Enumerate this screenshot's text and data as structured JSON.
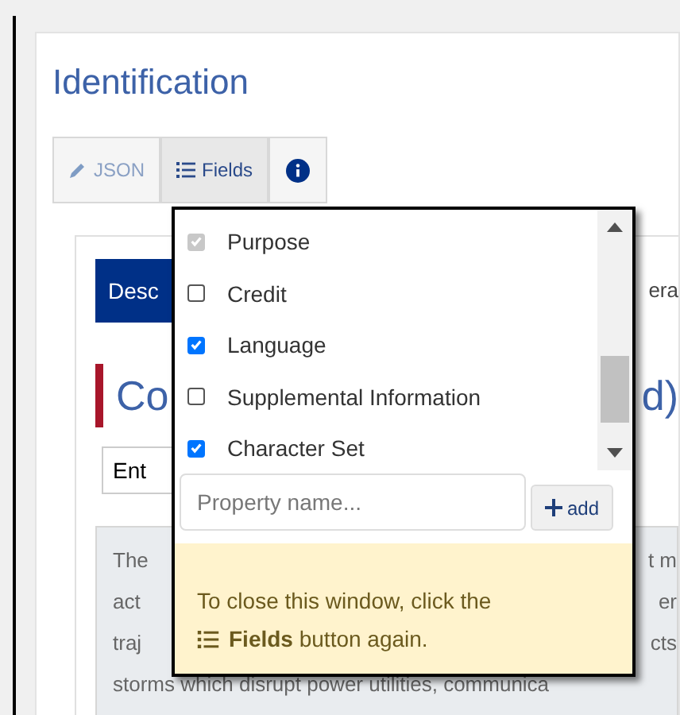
{
  "page": {
    "title": "Identification"
  },
  "toolbar": [
    {
      "kind": "json",
      "label": "JSON",
      "selected": false
    },
    {
      "kind": "fields",
      "label": "Fields",
      "selected": true
    },
    {
      "kind": "info",
      "selected": false
    }
  ],
  "background": {
    "tabs": [
      {
        "label": "Desc",
        "selected": true
      },
      {
        "label": "era",
        "selected": false
      }
    ],
    "heading_left": "Co",
    "heading_right": "d)",
    "input_value": "Ent",
    "paragraph_lines": [
      {
        "left": "The",
        "right": "t m"
      },
      {
        "left": "act",
        "right": "er"
      },
      {
        "left": "traj",
        "right": "cts"
      }
    ],
    "paragraph_last": "storms which disrupt power utilities, communica"
  },
  "popup": {
    "fields": [
      {
        "label": "Purpose",
        "checked": true,
        "disabled": true
      },
      {
        "label": "Credit",
        "checked": false,
        "disabled": false
      },
      {
        "label": "Language",
        "checked": true,
        "disabled": false
      },
      {
        "label": "Supplemental Information",
        "checked": false,
        "disabled": false
      },
      {
        "label": "Character Set",
        "checked": true,
        "disabled": false
      }
    ],
    "placeholder": "Property name...",
    "add_label": "add",
    "note_line1": "To close this window, click the",
    "note_line2": "**Fields** button again."
  }
}
